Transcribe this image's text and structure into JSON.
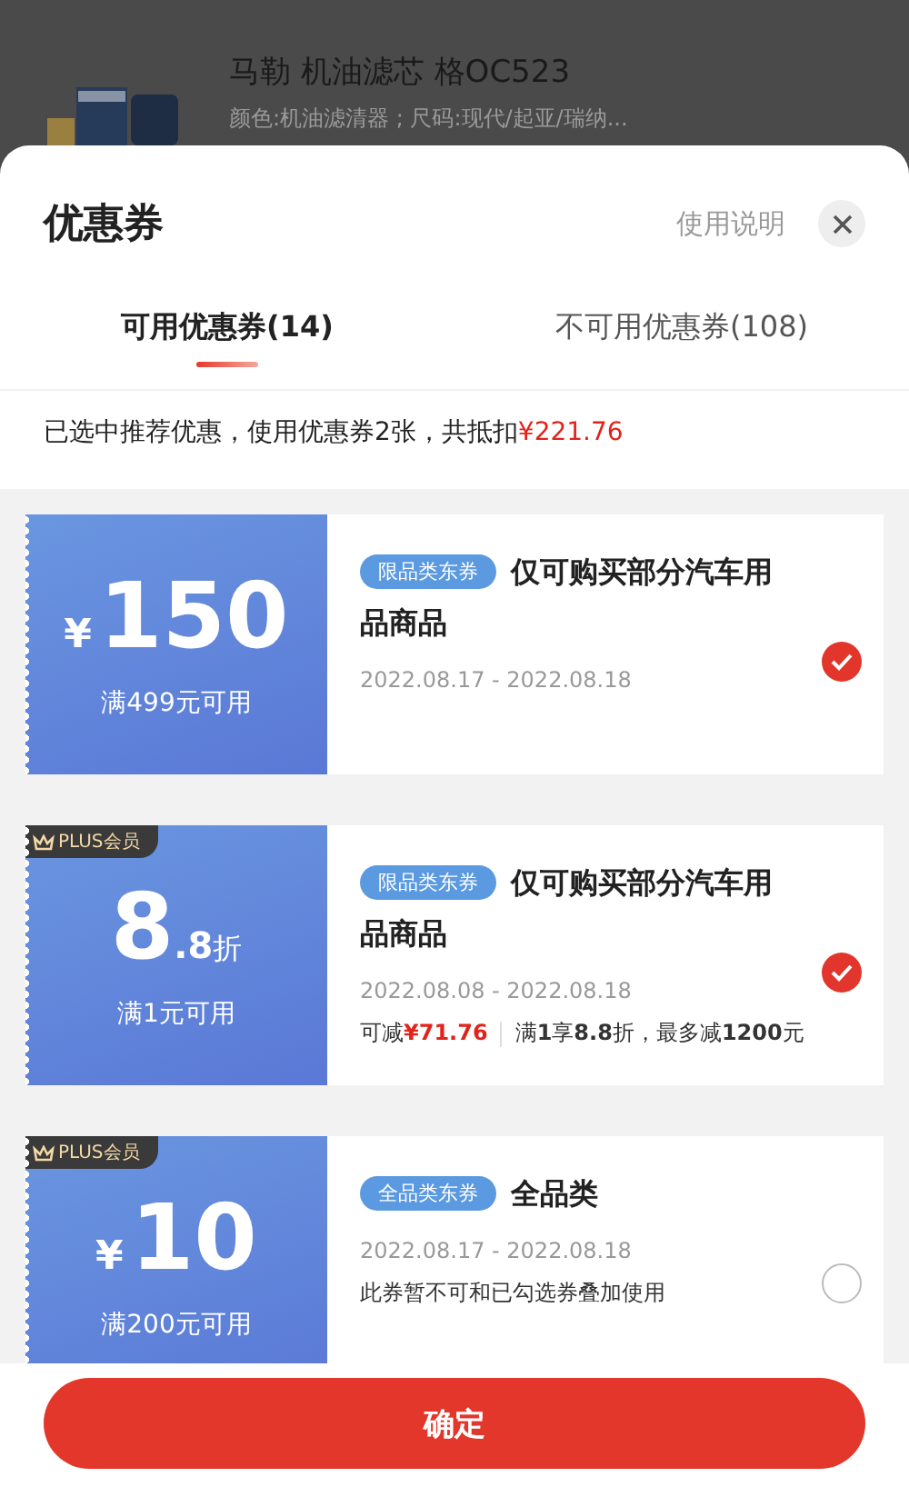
{
  "background_product": {
    "title": "马勒 机油滤芯 格OC523",
    "spec": "颜色:机油滤清器 ; 尺码:现代/起亚/瑞纳..."
  },
  "sheet": {
    "title": "优惠券",
    "help_link": "使用说明"
  },
  "tabs": [
    {
      "label": "可用优惠券(14)",
      "selected": true
    },
    {
      "label": "不可用优惠券(108)",
      "selected": false
    }
  ],
  "summary": {
    "text": "已选中推荐优惠，使用优惠券2张，共抵扣",
    "amount": "¥221.76"
  },
  "coupons": [
    {
      "kind": "amount",
      "currency": "¥",
      "value": "150",
      "condition": "满499元可用",
      "tag": "限品类东券",
      "title": "仅可购买部分汽车用品商品",
      "dates": "2022.08.17 - 2022.08.18",
      "selected": true
    },
    {
      "kind": "discount",
      "badge": "PLUS会员",
      "value": "8",
      "decimal": ".8",
      "unit": "折",
      "condition": "满1元可用",
      "tag": "限品类东券",
      "title": "仅可购买部分汽车用品商品",
      "dates": "2022.08.08 - 2022.08.18",
      "saving": {
        "label": "可减",
        "amount": "¥71.76"
      },
      "detail": "满**1**享**8.8**折，最多减**1200**元",
      "selected": true
    },
    {
      "kind": "amount",
      "badge": "PLUS会员",
      "currency": "¥",
      "value": "10",
      "condition": "满200元可用",
      "tag": "全品类东券",
      "title": "全品类",
      "dates": "2022.08.17 - 2022.08.18",
      "note": "此券暂不可和已勾选券叠加使用",
      "selected": false
    }
  ],
  "confirm_button": "确定"
}
